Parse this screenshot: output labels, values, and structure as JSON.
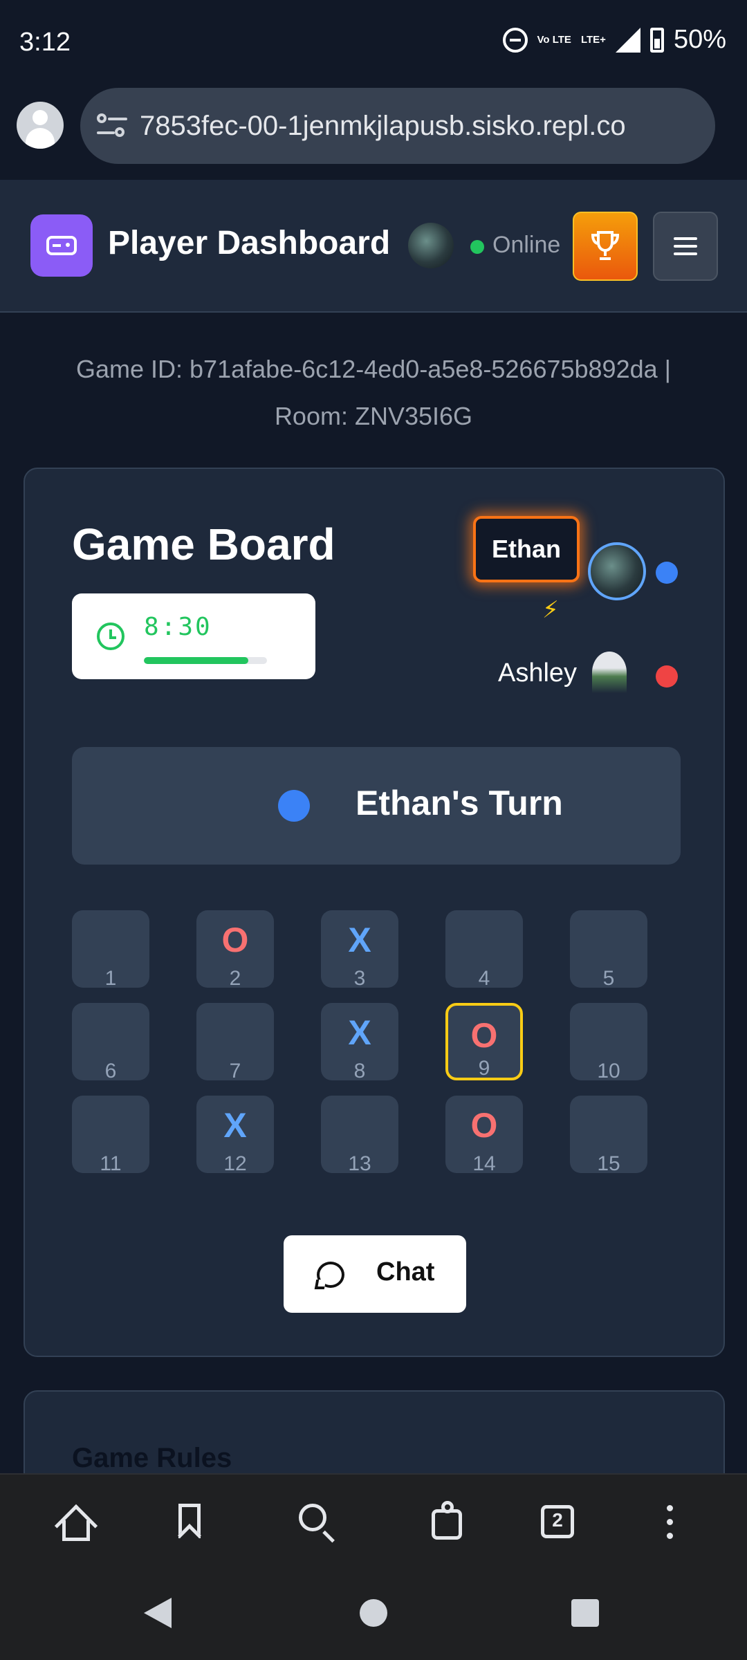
{
  "status_bar": {
    "time": "3:12",
    "volte": "Vo LTE",
    "lte": "LTE+",
    "battery": "50%"
  },
  "browser": {
    "url": "7853fec-00-1jenmkjlapusb.sisko.repl.co",
    "tab_count": "2"
  },
  "header": {
    "title": "Player Dashboard",
    "status": "Online"
  },
  "game_info": {
    "line1": "Game ID: b71afabe-6c12-4ed0-a5e8-526675b892da |",
    "line2": "Room: ZNV35I6G"
  },
  "board": {
    "title": "Game Board",
    "timer": "8:30",
    "timer_progress": 0.85,
    "players": [
      {
        "name": "Ethan",
        "color": "#3b82f6",
        "active": true,
        "badge": "⚡"
      },
      {
        "name": "Ashley",
        "color": "#ef4444",
        "active": false
      }
    ],
    "turn_text": "Ethan's Turn",
    "cells": [
      {
        "num": "1",
        "mark": ""
      },
      {
        "num": "2",
        "mark": "O"
      },
      {
        "num": "3",
        "mark": "X"
      },
      {
        "num": "4",
        "mark": ""
      },
      {
        "num": "5",
        "mark": ""
      },
      {
        "num": "6",
        "mark": ""
      },
      {
        "num": "7",
        "mark": ""
      },
      {
        "num": "8",
        "mark": "X"
      },
      {
        "num": "9",
        "mark": "O",
        "highlight": true
      },
      {
        "num": "10",
        "mark": ""
      },
      {
        "num": "11",
        "mark": ""
      },
      {
        "num": "12",
        "mark": "X"
      },
      {
        "num": "13",
        "mark": ""
      },
      {
        "num": "14",
        "mark": "O"
      },
      {
        "num": "15",
        "mark": ""
      }
    ],
    "chat_label": "Chat"
  },
  "rules": {
    "title": "Game Rules"
  }
}
